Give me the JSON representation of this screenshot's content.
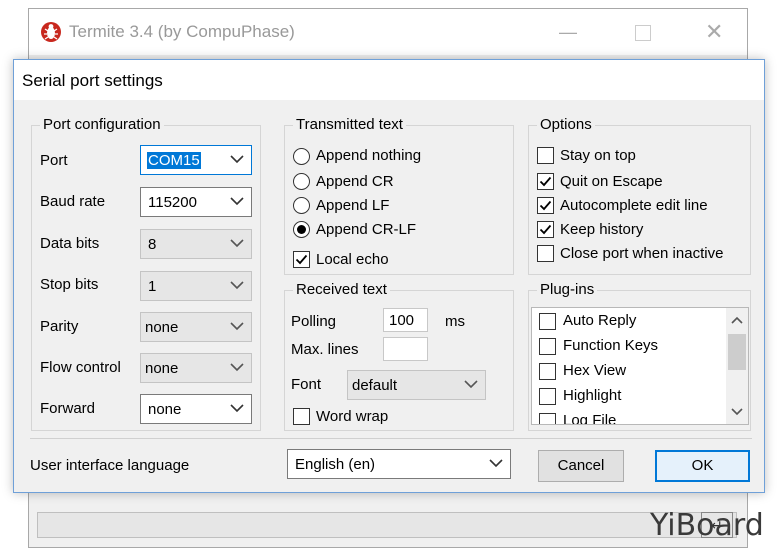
{
  "background_window": {
    "title": "Termite 3.4 (by CompuPhase)",
    "send_icon_glyph": "↵"
  },
  "dialog": {
    "title": "Serial port settings",
    "port_config": {
      "legend": "Port configuration",
      "port_label": "Port",
      "port_value": "COM15",
      "baud_label": "Baud rate",
      "baud_value": "115200",
      "data_bits_label": "Data bits",
      "data_bits_value": "8",
      "stop_bits_label": "Stop bits",
      "stop_bits_value": "1",
      "parity_label": "Parity",
      "parity_value": "none",
      "flow_label": "Flow control",
      "flow_value": "none",
      "forward_label": "Forward",
      "forward_value": "none"
    },
    "transmitted": {
      "legend": "Transmitted text",
      "options": [
        "Append nothing",
        "Append CR",
        "Append LF",
        "Append CR-LF"
      ],
      "selected_index": 3,
      "local_echo_label": "Local echo",
      "local_echo_checked": true
    },
    "received": {
      "legend": "Received text",
      "polling_label": "Polling",
      "polling_value": "100",
      "polling_unit": "ms",
      "max_lines_label": "Max. lines",
      "max_lines_value": "",
      "font_label": "Font",
      "font_value": "default",
      "word_wrap_label": "Word wrap",
      "word_wrap_checked": false
    },
    "options": {
      "legend": "Options",
      "items": [
        {
          "label": "Stay on top",
          "checked": false
        },
        {
          "label": "Quit on Escape",
          "checked": true
        },
        {
          "label": "Autocomplete edit line",
          "checked": true
        },
        {
          "label": "Keep history",
          "checked": true
        },
        {
          "label": "Close port when inactive",
          "checked": false
        }
      ]
    },
    "plugins": {
      "legend": "Plug-ins",
      "items": [
        {
          "label": "Auto Reply",
          "checked": false
        },
        {
          "label": "Function Keys",
          "checked": false
        },
        {
          "label": "Hex View",
          "checked": false
        },
        {
          "label": "Highlight",
          "checked": false
        },
        {
          "label": "Log File",
          "checked": false
        }
      ]
    },
    "ui_language_label": "User interface language",
    "ui_language_value": "English (en)",
    "cancel_label": "Cancel",
    "ok_label": "OK"
  },
  "watermark": "YiBoard",
  "colors": {
    "accent": "#0078d7",
    "dialog_bg": "#f0f0f0"
  }
}
